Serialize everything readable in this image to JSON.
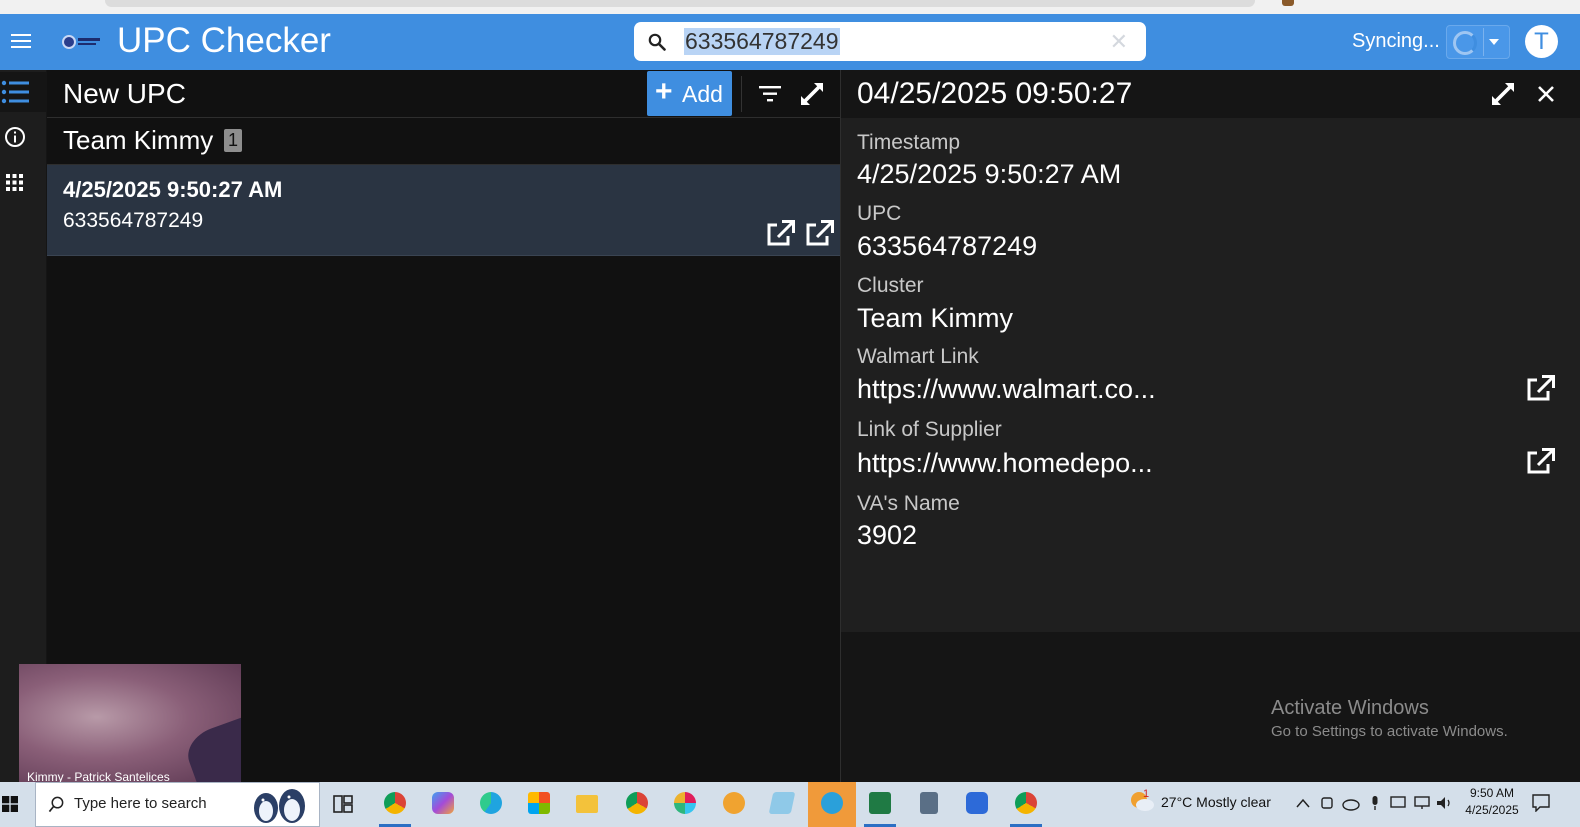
{
  "header": {
    "app_title": "UPC Checker",
    "search_value": "633564787249",
    "sync_status": "Syncing...",
    "user_initial": "T"
  },
  "list": {
    "title": "New UPC",
    "add_label": "Add",
    "group": {
      "name": "Team Kimmy",
      "count": "1"
    },
    "records": [
      {
        "timestamp": "4/25/2025 9:50:27 AM",
        "upc": "633564787249"
      }
    ]
  },
  "detail": {
    "title": "04/25/2025 09:50:27",
    "fields": [
      {
        "label": "Timestamp",
        "value": "4/25/2025 9:50:27 AM"
      },
      {
        "label": "UPC",
        "value": "633564787249"
      },
      {
        "label": "Cluster",
        "value": "Team Kimmy"
      },
      {
        "label": "Walmart Link",
        "value": "https://www.walmart.co..."
      },
      {
        "label": "Link of Supplier",
        "value": "https://www.homedepo..."
      },
      {
        "label": "VA's Name",
        "value": "3902"
      }
    ]
  },
  "watermark": {
    "line1": "Activate Windows",
    "line2": "Go to Settings to activate Windows."
  },
  "video": {
    "caption": "Kimmy - Patrick Santelices"
  },
  "taskbar": {
    "search_placeholder": "Type here to search",
    "weather": "27°C  Mostly clear",
    "weather_badge": "1",
    "time": "9:50 AM",
    "date": "4/25/2025"
  },
  "colors": {
    "accent": "#3f8ee0",
    "selected_row": "#2a3442",
    "panel_bg": "#111111",
    "detail_bg": "#1f1f1f"
  }
}
